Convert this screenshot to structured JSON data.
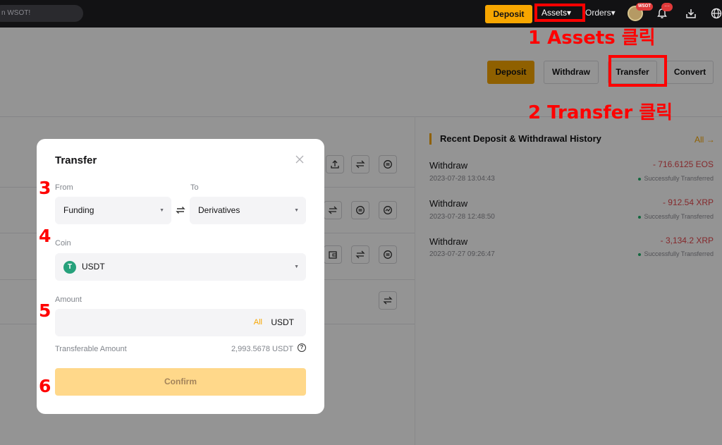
{
  "topbar": {
    "search_placeholder": "n WSOT!",
    "deposit_label": "Deposit",
    "assets_label": "Assets▾",
    "orders_label": "Orders▾",
    "avatar_badge": "WSOT",
    "notifications_badge": "···"
  },
  "page": {
    "actions": {
      "deposit": "Deposit",
      "withdraw": "Withdraw",
      "transfer": "Transfer",
      "convert": "Convert"
    },
    "history": {
      "title": "Recent Deposit & Withdrawal History",
      "all_label": "All",
      "items": [
        {
          "type": "Withdraw",
          "date": "2023-07-28 13:04:43",
          "amount": "- 716.6125 EOS",
          "status": "Successfully Transferred"
        },
        {
          "type": "Withdraw",
          "date": "2023-07-28 12:48:50",
          "amount": "- 912.54 XRP",
          "status": "Successfully Transferred"
        },
        {
          "type": "Withdraw",
          "date": "2023-07-27 09:26:47",
          "amount": "- 3,134.2 XRP",
          "status": "Successfully Transferred"
        }
      ]
    }
  },
  "modal": {
    "title": "Transfer",
    "from_label": "From",
    "to_label": "To",
    "from_value": "Funding",
    "to_value": "Derivatives",
    "coin_label": "Coin",
    "coin_value": "USDT",
    "coin_symbol": "T",
    "amount_label": "Amount",
    "amount_all": "All",
    "amount_unit": "USDT",
    "transferable_label": "Transferable Amount",
    "transferable_value": "2,993.5678 USDT",
    "confirm_label": "Confirm"
  },
  "annotations": {
    "step1": "1 Assets 클릭",
    "step2": "2 Transfer 클릭",
    "step3": "3",
    "step4": "4",
    "step5": "5",
    "step6": "6"
  },
  "colors": {
    "accent": "#f7a600",
    "annotation": "#ff0000",
    "negative": "#e5484d",
    "success": "#20b26c"
  }
}
